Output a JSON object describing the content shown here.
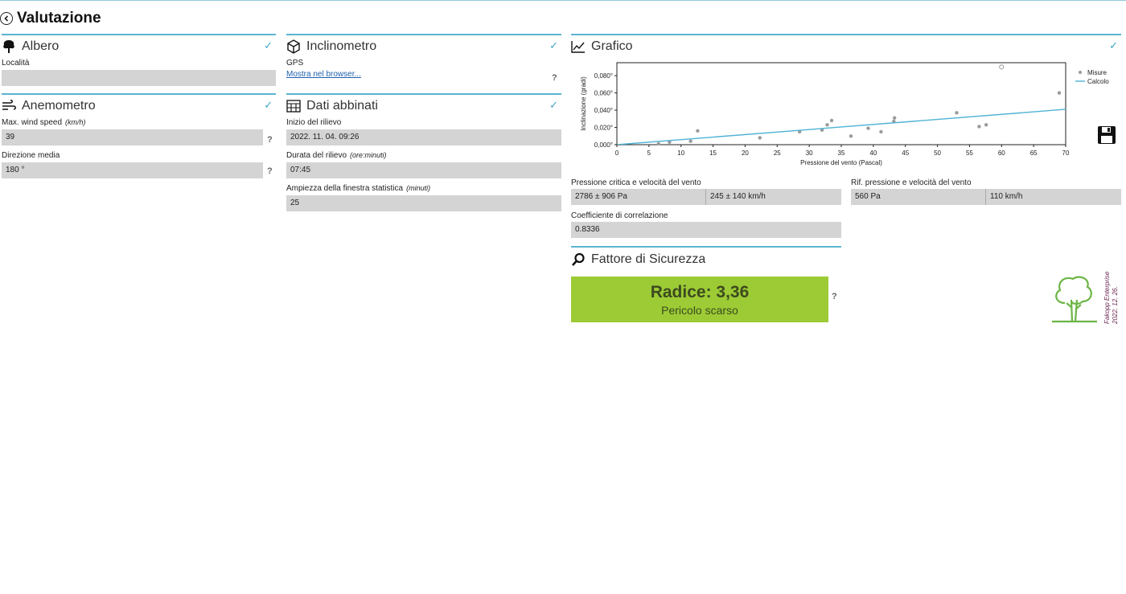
{
  "page": {
    "title": "Valutazione"
  },
  "albero": {
    "title": "Albero",
    "location_label": "Località",
    "location_value": ""
  },
  "anemometro": {
    "title": "Anemometro",
    "wind_label": "Max. wind speed",
    "wind_unit": "(km/h)",
    "wind_value": "39",
    "direction_label": "Direzione media",
    "direction_value": "180 °"
  },
  "inclinometro": {
    "title": "Inclinometro",
    "gps_label": "GPS",
    "gps_link": "Mostra nel browser..."
  },
  "dati": {
    "title": "Dati abbinati",
    "start_label": "Inizio del rilievo",
    "start_value": "2022. 11. 04.  09:26",
    "duration_label": "Durata del rilievo",
    "duration_unit": "(ore:minuti)",
    "duration_value": "07:45",
    "window_label": "Ampiezza della finestra statistica",
    "window_unit": "(minuti)",
    "window_value": "25"
  },
  "grafico": {
    "title": "Grafico",
    "critical_label": "Pressione critica e velocità del vento",
    "critical_pressure": "2786 ± 906 Pa",
    "critical_speed": "245 ± 140 km/h",
    "ref_label": "Rif. pressione e velocità del vento",
    "ref_pressure": "560 Pa",
    "ref_speed": "110 km/h",
    "corr_label": "Coefficiente di correlazione",
    "corr_value": "0.8336"
  },
  "safety": {
    "title": "Fattore di Sicurezza",
    "main": "Radice: 3,36",
    "sub": "Pericolo scarso",
    "color": "#9ccb35"
  },
  "brand": {
    "line1": "Fakopp Enterprise",
    "line2": "2022. 12. 26."
  },
  "question_mark": "?",
  "colors": {
    "accent": "#5bb4d0",
    "check": "#3ea6c6",
    "field": "#d4d4d4",
    "line": "#4fb3d6",
    "points": "#9a9a9a"
  },
  "chart_data": {
    "type": "scatter",
    "xlabel": "Pressione del vento (Pascal)",
    "ylabel": "Inclinazione (gradi)",
    "xlim": [
      0,
      70
    ],
    "ylim": [
      0,
      0.095
    ],
    "x_ticks": [
      "0",
      "5",
      "10",
      "15",
      "20",
      "25",
      "30",
      "35",
      "40",
      "45",
      "50",
      "55",
      "60",
      "65",
      "70"
    ],
    "y_ticks": [
      "0,000°",
      "0,020°",
      "0,040°",
      "0,060°",
      "0,080°"
    ],
    "legend": [
      "Misure",
      "Calcolo"
    ],
    "legend_position": "right",
    "series": [
      {
        "name": "Misure",
        "kind": "points",
        "points": [
          [
            6.5,
            0.001
          ],
          [
            8.2,
            0.003
          ],
          [
            11.5,
            0.004
          ],
          [
            12.6,
            0.016
          ],
          [
            22.3,
            0.008
          ],
          [
            28.5,
            0.015
          ],
          [
            32,
            0.017
          ],
          [
            32.8,
            0.023
          ],
          [
            33.5,
            0.028
          ],
          [
            36.5,
            0.01
          ],
          [
            39.2,
            0.019
          ],
          [
            41.2,
            0.015
          ],
          [
            43.2,
            0.027
          ],
          [
            43.3,
            0.031
          ],
          [
            53,
            0.037
          ],
          [
            56.5,
            0.021
          ],
          [
            57.6,
            0.023
          ],
          [
            69,
            0.06
          ]
        ]
      },
      {
        "name": "Misure outlier",
        "kind": "hollow",
        "points": [
          [
            60,
            0.09
          ]
        ]
      },
      {
        "name": "Calcolo",
        "kind": "line",
        "points": [
          [
            0,
            0.0
          ],
          [
            70,
            0.041
          ]
        ]
      }
    ]
  }
}
